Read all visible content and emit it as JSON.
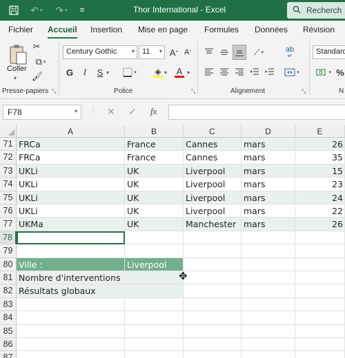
{
  "window": {
    "title": "Thor International  -  Excel",
    "search_label": "Recherch"
  },
  "ribbon_tabs": [
    "Fichier",
    "Accueil",
    "Insertion",
    "Mise en page",
    "Formules",
    "Données",
    "Révision"
  ],
  "ribbon": {
    "groups": {
      "clipboard": "Presse-papiers",
      "font": "Police",
      "alignment": "Alignement",
      "number_partial": "N"
    },
    "paste_label": "Coller",
    "font_name": "Century Gothic",
    "font_size": "11",
    "number_format": "Standard",
    "bold": "G",
    "italic": "I",
    "underline": "S",
    "grow_font": "A",
    "shrink_font": "A",
    "font_color_letter": "A",
    "wrap_label": "ab",
    "highlight_color": "#ffff00",
    "font_color": "#ff0000"
  },
  "formula_bar": {
    "name_box": "F78",
    "fx": "fx",
    "formula": ""
  },
  "columns": [
    "A",
    "B",
    "C",
    "D",
    "E"
  ],
  "rows": [
    {
      "num": "71",
      "A": "FRCa",
      "B": "France",
      "C": "Cannes",
      "D": "mars",
      "E": "26"
    },
    {
      "num": "72",
      "A": "FRCa",
      "B": "France",
      "C": "Cannes",
      "D": "mars",
      "E": "35"
    },
    {
      "num": "73",
      "A": "UKLi",
      "B": "UK",
      "C": "Liverpool",
      "D": "mars",
      "E": "15"
    },
    {
      "num": "74",
      "A": "UKLi",
      "B": "UK",
      "C": "Liverpool",
      "D": "mars",
      "E": "23"
    },
    {
      "num": "75",
      "A": "UKLi",
      "B": "UK",
      "C": "Liverpool",
      "D": "mars",
      "E": "24"
    },
    {
      "num": "76",
      "A": "UKLi",
      "B": "UK",
      "C": "Liverpool",
      "D": "mars",
      "E": "22"
    },
    {
      "num": "77",
      "A": "UKMa",
      "B": "UK",
      "C": "Manchester",
      "D": "mars",
      "E": "26"
    },
    {
      "num": "78",
      "A": "",
      "B": "",
      "C": "",
      "D": "",
      "E": ""
    },
    {
      "num": "79",
      "A": "",
      "B": "",
      "C": "",
      "D": "",
      "E": ""
    },
    {
      "num": "80",
      "A": "Ville :",
      "B": "Liverpool",
      "C": "",
      "D": "",
      "E": ""
    },
    {
      "num": "81",
      "A": "Nombre d'interventions",
      "B": "",
      "C": "",
      "D": "",
      "E": ""
    },
    {
      "num": "82",
      "A": "Résultats globaux",
      "B": "",
      "C": "",
      "D": "",
      "E": ""
    },
    {
      "num": "83",
      "A": "",
      "B": "",
      "C": "",
      "D": "",
      "E": ""
    },
    {
      "num": "84",
      "A": "",
      "B": "",
      "C": "",
      "D": "",
      "E": ""
    },
    {
      "num": "85",
      "A": "",
      "B": "",
      "C": "",
      "D": "",
      "E": ""
    },
    {
      "num": "86",
      "A": "",
      "B": "",
      "C": "",
      "D": "",
      "E": ""
    },
    {
      "num": "87",
      "A": "",
      "B": "",
      "C": "",
      "D": "",
      "E": ""
    }
  ],
  "colors": {
    "excel_green": "#217346",
    "title_bar": "#1f7145",
    "band_fill": "#e9f1ec",
    "highlight_fill": "#72b08c"
  }
}
